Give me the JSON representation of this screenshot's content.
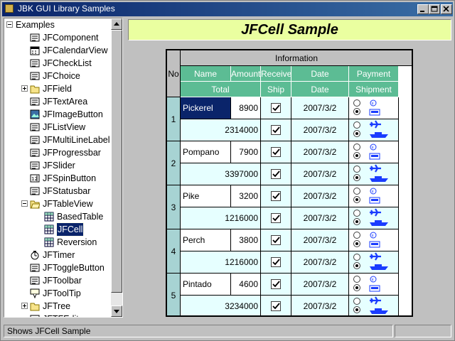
{
  "window": {
    "title": "JBK GUI Library Samples"
  },
  "tree": {
    "root_label": "Examples",
    "items": [
      {
        "label": "JFComponent",
        "icon": "component-icon",
        "expander": ""
      },
      {
        "label": "JFCalendarView",
        "icon": "calendar-icon",
        "expander": ""
      },
      {
        "label": "JFCheckList",
        "icon": "checklist-icon",
        "expander": ""
      },
      {
        "label": "JFChoice",
        "icon": "choice-icon",
        "expander": ""
      },
      {
        "label": "JFField",
        "icon": "folder-icon",
        "expander": "plus"
      },
      {
        "label": "JFTextArea",
        "icon": "textarea-icon",
        "expander": ""
      },
      {
        "label": "JFImageButton",
        "icon": "image-button-icon",
        "expander": ""
      },
      {
        "label": "JFListView",
        "icon": "listview-icon",
        "expander": ""
      },
      {
        "label": "JFMultiLineLabel",
        "icon": "multiline-label-icon",
        "expander": ""
      },
      {
        "label": "JFProgressbar",
        "icon": "progressbar-icon",
        "expander": ""
      },
      {
        "label": "JFSlider",
        "icon": "slider-icon",
        "expander": ""
      },
      {
        "label": "JFSpinButton",
        "icon": "spinbutton-icon",
        "expander": ""
      },
      {
        "label": "JFStatusbar",
        "icon": "statusbar-icon",
        "expander": ""
      },
      {
        "label": "JFTableView",
        "icon": "folder-open-icon",
        "expander": "minus"
      },
      {
        "label": "BasedTable",
        "icon": "table-icon",
        "expander": "",
        "child": true
      },
      {
        "label": "JFCell",
        "icon": "table-icon",
        "expander": "",
        "child": true,
        "selected": true
      },
      {
        "label": "Reversion",
        "icon": "table-icon",
        "expander": "",
        "child": true
      },
      {
        "label": "JFTimer",
        "icon": "timer-icon",
        "expander": ""
      },
      {
        "label": "JFToggleButton",
        "icon": "toggle-button-icon",
        "expander": ""
      },
      {
        "label": "JFToolbar",
        "icon": "toolbar-icon",
        "expander": ""
      },
      {
        "label": "JFToolTip",
        "icon": "tooltip-icon",
        "expander": ""
      },
      {
        "label": "JFTree",
        "icon": "folder-icon",
        "expander": "plus"
      },
      {
        "label": "JFTFEditor",
        "icon": "editor-icon",
        "expander": ""
      }
    ]
  },
  "sample": {
    "title": "JFCell Sample"
  },
  "table": {
    "header_no": "No",
    "header_group": "Information",
    "headers_row1": [
      "Name",
      "Amount",
      "Receive",
      "Date",
      "Payment"
    ],
    "headers_row2": [
      "Total",
      "Ship",
      "Date",
      "Shipment"
    ],
    "rows": [
      {
        "no": "1",
        "name": "Pickerel",
        "amount": "8900",
        "total": "2314000",
        "date1": "2007/3/2",
        "date2": "2007/3/2",
        "payment": "credit",
        "shipment": "ship",
        "selected": true
      },
      {
        "no": "2",
        "name": "Pompano",
        "amount": "7900",
        "total": "3397000",
        "date1": "2007/3/2",
        "date2": "2007/3/2",
        "payment": "cash",
        "shipment": "ship"
      },
      {
        "no": "3",
        "name": "Pike",
        "amount": "3200",
        "total": "1216000",
        "date1": "2007/3/2",
        "date2": "2007/3/2",
        "payment": "cash",
        "shipment": "ship"
      },
      {
        "no": "4",
        "name": "Perch",
        "amount": "3800",
        "total": "1216000",
        "date1": "2007/3/2",
        "date2": "2007/3/2",
        "payment": "cash",
        "shipment": "ship"
      },
      {
        "no": "5",
        "name": "Pintado",
        "amount": "4600",
        "total": "3234000",
        "date1": "2007/3/2",
        "date2": "2007/3/2",
        "payment": "cash",
        "shipment": "ship"
      }
    ]
  },
  "status": {
    "text": "Shows JFCell Sample"
  },
  "colors": {
    "header_green": "#5cbc94",
    "row_no_teal": "#a7d3d3",
    "sample_banner": "#eaffa0",
    "selection": "#0a246a"
  }
}
